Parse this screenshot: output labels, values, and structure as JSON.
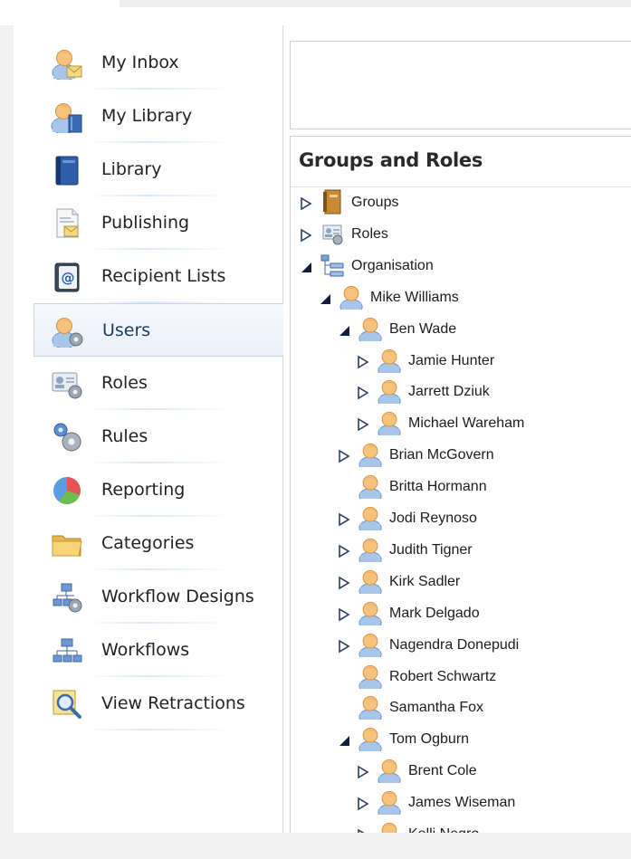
{
  "sidebar": {
    "items": [
      {
        "label": "My Inbox",
        "icon": "user-mail-icon"
      },
      {
        "label": "My Library",
        "icon": "user-library-icon"
      },
      {
        "label": "Library",
        "icon": "book-icon"
      },
      {
        "label": "Publishing",
        "icon": "document-mail-icon"
      },
      {
        "label": "Recipient Lists",
        "icon": "address-book-icon"
      },
      {
        "label": "Users",
        "icon": "user-gear-icon",
        "active": true
      },
      {
        "label": "Roles",
        "icon": "id-card-gear-icon"
      },
      {
        "label": "Rules",
        "icon": "gears-icon"
      },
      {
        "label": "Reporting",
        "icon": "pie-chart-icon"
      },
      {
        "label": "Categories",
        "icon": "folder-icon"
      },
      {
        "label": "Workflow Designs",
        "icon": "workflow-gear-icon"
      },
      {
        "label": "Workflows",
        "icon": "workflow-icon"
      },
      {
        "label": "View Retractions",
        "icon": "magnifier-icon"
      }
    ]
  },
  "tree": {
    "title": "Groups and Roles",
    "nodes": [
      {
        "label": "Groups",
        "level": 0,
        "expander": "collapsed",
        "icon": "groups-book-icon"
      },
      {
        "label": "Roles",
        "level": 0,
        "expander": "collapsed",
        "icon": "roles-card-icon"
      },
      {
        "label": "Organisation",
        "level": 0,
        "expander": "expanded",
        "icon": "org-tree-icon"
      },
      {
        "label": "Mike Williams",
        "level": 1,
        "expander": "expanded",
        "icon": "user-icon"
      },
      {
        "label": "Ben Wade",
        "level": 2,
        "expander": "expanded",
        "icon": "user-icon"
      },
      {
        "label": "Jamie Hunter",
        "level": 3,
        "expander": "collapsed",
        "icon": "user-icon"
      },
      {
        "label": "Jarrett Dziuk",
        "level": 3,
        "expander": "collapsed",
        "icon": "user-icon"
      },
      {
        "label": "Michael Wareham",
        "level": 3,
        "expander": "collapsed",
        "icon": "user-icon"
      },
      {
        "label": "Brian McGovern",
        "level": 2,
        "expander": "collapsed",
        "icon": "user-icon"
      },
      {
        "label": "Britta Hormann",
        "level": 2,
        "expander": "none",
        "icon": "user-icon"
      },
      {
        "label": "Jodi Reynoso",
        "level": 2,
        "expander": "collapsed",
        "icon": "user-icon"
      },
      {
        "label": "Judith Tigner",
        "level": 2,
        "expander": "collapsed",
        "icon": "user-icon"
      },
      {
        "label": "Kirk Sadler",
        "level": 2,
        "expander": "collapsed",
        "icon": "user-icon"
      },
      {
        "label": "Mark Delgado",
        "level": 2,
        "expander": "collapsed",
        "icon": "user-icon"
      },
      {
        "label": "Nagendra Donepudi",
        "level": 2,
        "expander": "collapsed",
        "icon": "user-icon"
      },
      {
        "label": "Robert Schwartz",
        "level": 2,
        "expander": "none",
        "icon": "user-icon"
      },
      {
        "label": "Samantha Fox",
        "level": 2,
        "expander": "none",
        "icon": "user-icon"
      },
      {
        "label": "Tom Ogburn",
        "level": 2,
        "expander": "expanded",
        "icon": "user-icon"
      },
      {
        "label": "Brent Cole",
        "level": 3,
        "expander": "collapsed",
        "icon": "user-icon"
      },
      {
        "label": "James Wiseman",
        "level": 3,
        "expander": "collapsed",
        "icon": "user-icon"
      },
      {
        "label": "Kelli Negro",
        "level": 3,
        "expander": "collapsed",
        "icon": "user-icon"
      }
    ]
  },
  "colors": {
    "active_bg": "#eaf1f9",
    "active_border": "#c8d6e6",
    "person_head": "#f3b467",
    "person_body": "#8fb4e3"
  }
}
